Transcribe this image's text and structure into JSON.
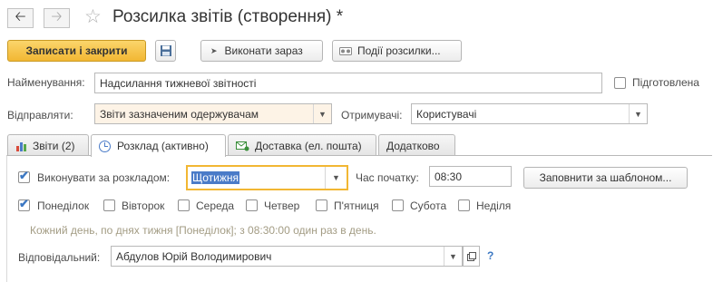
{
  "window": {
    "title": "Розсилка звітів (створення) *"
  },
  "toolbar": {
    "save_close_label": "Записати і закрити",
    "run_now_label": "Виконати зараз",
    "events_label": "Події розсилки..."
  },
  "form": {
    "name_label": "Найменування:",
    "name_value": "Надсилання тижневої звітності",
    "prepared_label": "Підготовлена",
    "send_label": "Відправляти:",
    "send_value": "Звіти зазначеним одержувачам",
    "recipients_label": "Отримувачі:",
    "recipients_value": "Користувачі"
  },
  "tabs": [
    {
      "label": "Звіти (2)"
    },
    {
      "label": "Розклад (активно)"
    },
    {
      "label": "Доставка (ел. пошта)"
    },
    {
      "label": "Додатково"
    }
  ],
  "schedule": {
    "run_by_schedule_label": "Виконувати за розкладом:",
    "period_value": "Щотижня",
    "start_time_label": "Час початку:",
    "start_time_value": "08:30",
    "fill_template_label": "Заповнити за шаблоном...",
    "days": [
      {
        "label": "Понеділок",
        "checked": true
      },
      {
        "label": "Вівторок",
        "checked": false
      },
      {
        "label": "Середа",
        "checked": false
      },
      {
        "label": "Четвер",
        "checked": false
      },
      {
        "label": "П'ятниця",
        "checked": false
      },
      {
        "label": "Субота",
        "checked": false
      },
      {
        "label": "Неділя",
        "checked": false
      }
    ],
    "hint": "Кожний день, по днях тижня [Понеділок]; з 08:30:00 один раз в день.",
    "responsible_label": "Відповідальний:",
    "responsible_value": "Абдулов Юрій Володимирович",
    "help": "?"
  },
  "colors": {
    "primary": "#f2b733",
    "accent": "#3c78c3",
    "required_bg": "#fdf3e6"
  },
  "icons": [
    "back-arrow-icon",
    "forward-arrow-icon",
    "star-icon",
    "save-icon",
    "run-icon",
    "events-icon",
    "chart-icon",
    "clock-icon",
    "mail-icon",
    "open-icon",
    "help-icon"
  ]
}
